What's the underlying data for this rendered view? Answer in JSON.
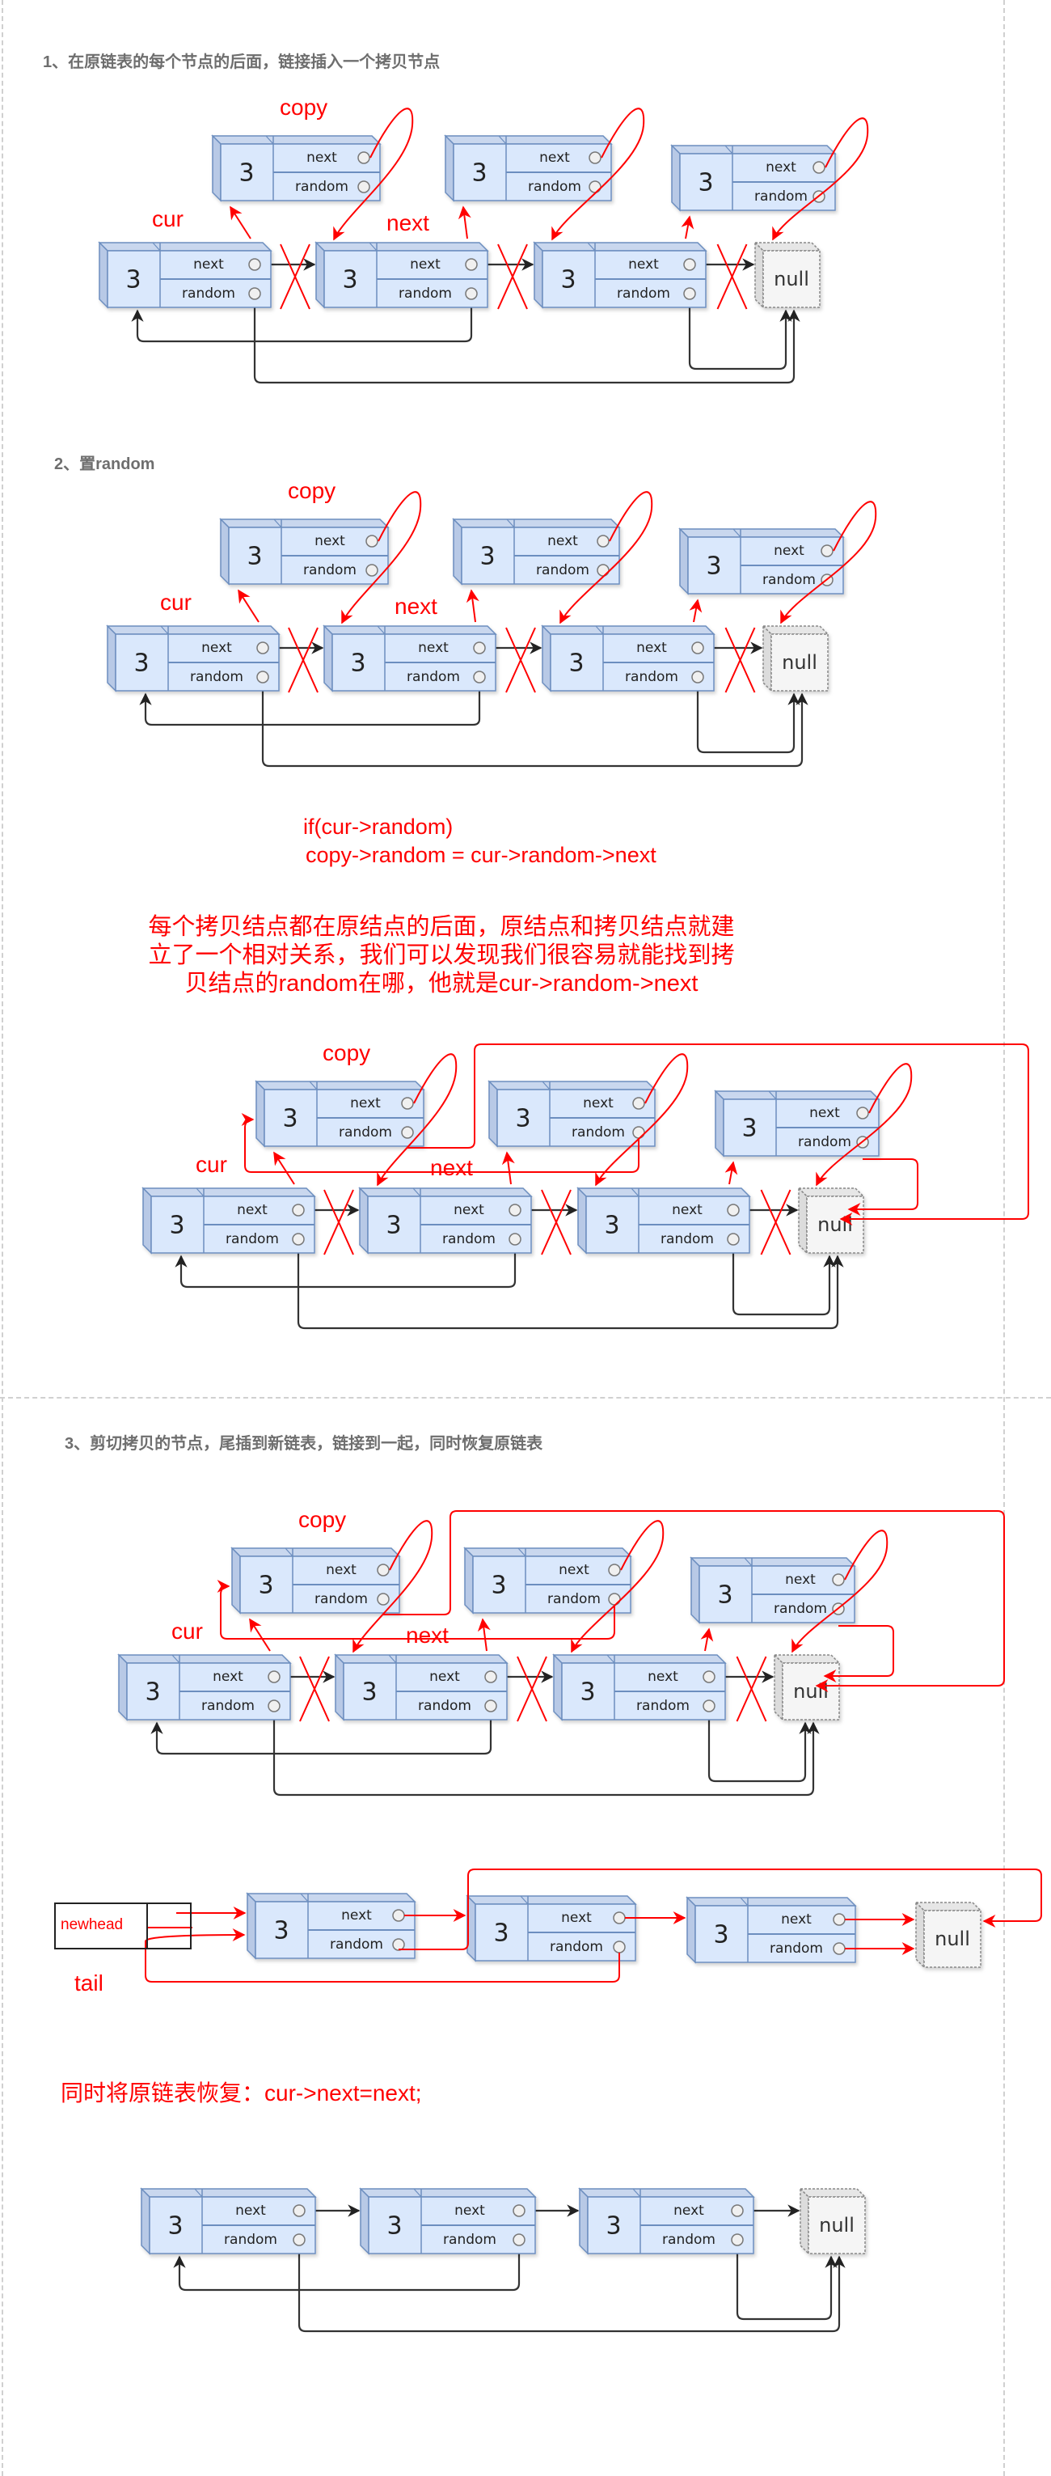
{
  "sections": [
    {
      "title": "1、在原链表的每个节点的后面，链接插入一个拷贝节点"
    },
    {
      "title": "2、置random"
    },
    {
      "title": "3、剪切拷贝的节点，尾插到新链表，链接到一起，同时恢复原链表"
    }
  ],
  "labels": {
    "copy": "copy",
    "cur": "cur",
    "next": "next",
    "newhead": "newhead",
    "tail": "tail"
  },
  "code": {
    "line1": "if(cur->random)",
    "line2": "copy->random = cur->random->next"
  },
  "explanation": {
    "line1": "每个拷贝结点都在原结点的后面，原结点和拷贝结点就建",
    "line2": "立了一个相对关系，我们可以发现我们很容易就能找到拷",
    "line3": "贝结点的random在哪，他就是cur->random->next"
  },
  "restore_note": "同时将原链表恢复：cur->next=next;",
  "node": {
    "value": "3",
    "next_field": "next",
    "random_field": "random",
    "null_label": "null"
  },
  "colors": {
    "node_fill": "#dae8fc",
    "node_top": "#c9d7ee",
    "node_stroke": "#6c8ebf",
    "null_fill": "#f5f5f5",
    "null_stroke": "#888888",
    "annotation": "#ff0000",
    "edge": "#333333",
    "title": "#6e6e6e"
  },
  "diagrams": [
    {
      "id": "step1-insert-copies",
      "nodes": 3,
      "copies": 3,
      "has_cross_links": false
    },
    {
      "id": "step2-set-random",
      "nodes": 3,
      "copies": 3,
      "has_cross_links": false
    },
    {
      "id": "step2-random-result",
      "nodes": 3,
      "copies": 3,
      "has_cross_links": true
    },
    {
      "id": "step3-cut-copies",
      "nodes": 3,
      "copies": 3,
      "has_cross_links": true
    },
    {
      "id": "step3-new-list",
      "nodes": 3,
      "copies": 0
    },
    {
      "id": "step3-restored-list",
      "nodes": 3,
      "copies": 0
    }
  ]
}
